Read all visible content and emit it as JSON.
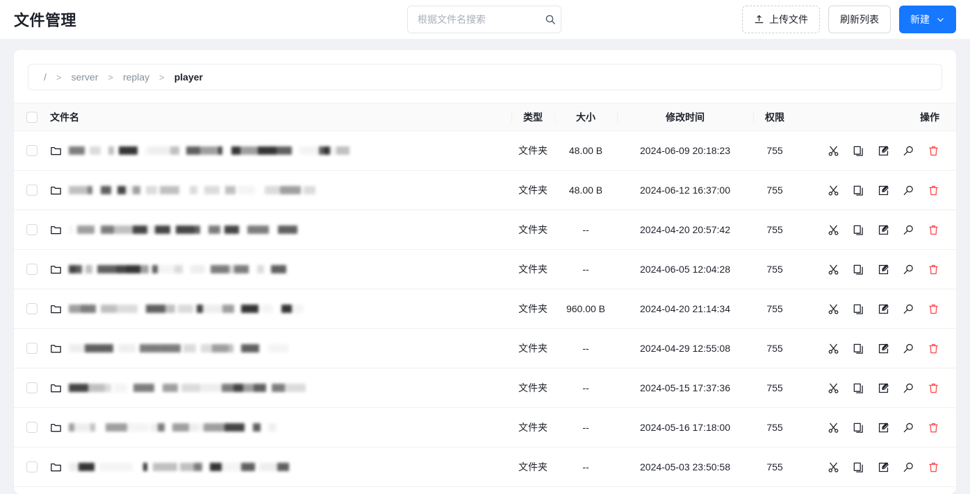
{
  "header": {
    "title": "文件管理",
    "search": {
      "placeholder": "根据文件名搜索",
      "value": "",
      "icon": "search-icon"
    },
    "buttons": {
      "upload": {
        "label": "上传文件",
        "icon": "upload-icon"
      },
      "refresh": {
        "label": "刷新列表"
      },
      "new": {
        "label": "新建",
        "icon": "chevron-down-icon",
        "color": "#1677ff"
      }
    }
  },
  "breadcrumb": {
    "separator": ">",
    "items": [
      {
        "label": "/",
        "active": false
      },
      {
        "label": "server",
        "active": false
      },
      {
        "label": "replay",
        "active": false
      },
      {
        "label": "player",
        "active": true
      }
    ]
  },
  "table": {
    "columns": {
      "name": "文件名",
      "type": "类型",
      "size": "大小",
      "modified": "修改时间",
      "permission": "权限",
      "operations": "操作"
    },
    "operation_icons": [
      "cut-icon",
      "copy-icon",
      "edit-icon",
      "preview-icon",
      "delete-icon"
    ],
    "rows": [
      {
        "name": "",
        "redacted": true,
        "icon": "folder-icon",
        "type": "文件夹",
        "size": "48.00 B",
        "modified": "2024-06-09 20:18:23",
        "permission": "755"
      },
      {
        "name": "",
        "redacted": true,
        "icon": "folder-icon",
        "type": "文件夹",
        "size": "48.00 B",
        "modified": "2024-06-12 16:37:00",
        "permission": "755"
      },
      {
        "name": "",
        "redacted": true,
        "icon": "folder-icon",
        "type": "文件夹",
        "size": "--",
        "modified": "2024-04-20 20:57:42",
        "permission": "755"
      },
      {
        "name": "",
        "redacted": true,
        "icon": "folder-icon",
        "type": "文件夹",
        "size": "--",
        "modified": "2024-06-05 12:04:28",
        "permission": "755"
      },
      {
        "name": "",
        "redacted": true,
        "icon": "folder-icon",
        "type": "文件夹",
        "size": "960.00 B",
        "modified": "2024-04-20 21:14:34",
        "permission": "755"
      },
      {
        "name": "",
        "redacted": true,
        "icon": "folder-icon",
        "type": "文件夹",
        "size": "--",
        "modified": "2024-04-29 12:55:08",
        "permission": "755"
      },
      {
        "name": "",
        "redacted": true,
        "icon": "folder-icon",
        "type": "文件夹",
        "size": "--",
        "modified": "2024-05-15 17:37:36",
        "permission": "755"
      },
      {
        "name": "",
        "redacted": true,
        "icon": "folder-icon",
        "type": "文件夹",
        "size": "--",
        "modified": "2024-05-16 17:18:00",
        "permission": "755"
      },
      {
        "name": "",
        "redacted": true,
        "icon": "folder-icon",
        "type": "文件夹",
        "size": "--",
        "modified": "2024-05-03 23:50:58",
        "permission": "755"
      }
    ]
  }
}
